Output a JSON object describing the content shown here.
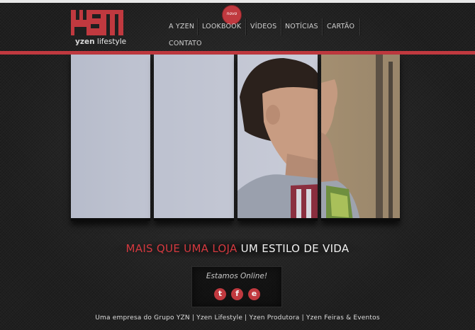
{
  "brand": {
    "logo_mark": "YZN",
    "logo_name_bold": "yzen",
    "logo_name_rest": " lifestyle",
    "accent_color": "#c0393f"
  },
  "nav": {
    "badge": "novo",
    "items": [
      {
        "label": "A YZEN"
      },
      {
        "label": "LOOKBOOK"
      },
      {
        "label": "VÍDEOS"
      },
      {
        "label": "NOTÍCIAS"
      },
      {
        "label": "CARTÃO"
      },
      {
        "label": "CONTATO"
      }
    ]
  },
  "slogan": {
    "red_part": "MAIS QUE UMA LOJA",
    "white_part": "UM ESTILO DE VIDA"
  },
  "online": {
    "title": "Estamos Online!",
    "social": [
      {
        "icon": "twitter-icon",
        "glyph": "t"
      },
      {
        "icon": "facebook-icon",
        "glyph": "f"
      },
      {
        "icon": "blog-icon",
        "glyph": "e"
      }
    ]
  },
  "footer": {
    "text": "Uma empresa do Grupo YZN | Yzen Lifestyle | Yzen Produtora | Yzen Feiras & Eventos"
  }
}
